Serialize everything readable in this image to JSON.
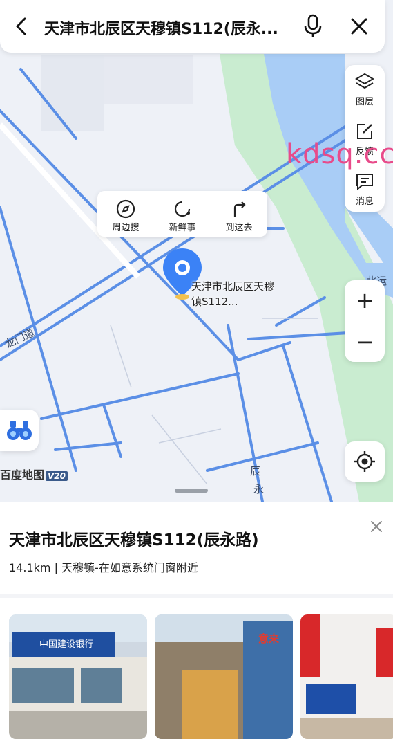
{
  "search": {
    "title": "天津市北辰区天穆镇S112(辰永..."
  },
  "watermark": "kdsq.cc",
  "side_panel": {
    "layers_label": "图层",
    "feedback_label": "反馈",
    "messages_label": "消息"
  },
  "zoom": {
    "in_label": "+",
    "out_label": "−"
  },
  "pin_actions": [
    {
      "label": "周边搜",
      "icon": "compass-icon"
    },
    {
      "label": "新鲜事",
      "icon": "refresh-icon"
    },
    {
      "label": "到这去",
      "icon": "route-icon"
    }
  ],
  "pin_label": "天津市北辰区天穆镇S112...",
  "road_labels": {
    "longmen": "龙门道",
    "beiyunhe": "北运河",
    "chenyong_1": "辰",
    "chenyong_2": "永"
  },
  "logo": {
    "text": "百度地图",
    "version": "V20"
  },
  "place": {
    "title": "天津市北辰区天穆镇S112(辰永路)",
    "info": "14.1km | 天穆镇-在如意系统门窗附近"
  },
  "photos": [
    {
      "name": "China Construction Bank storefront",
      "sign": "中国建设银行"
    },
    {
      "name": "shop street",
      "sign": "意来"
    },
    {
      "name": "appliance store interior",
      "sign": ""
    }
  ],
  "colors": {
    "accent": "#3b82f6",
    "road": "#5b8fe6",
    "water": "#9ec4f5",
    "green": "#c5ecc8",
    "watermark": "#e84b8a"
  }
}
